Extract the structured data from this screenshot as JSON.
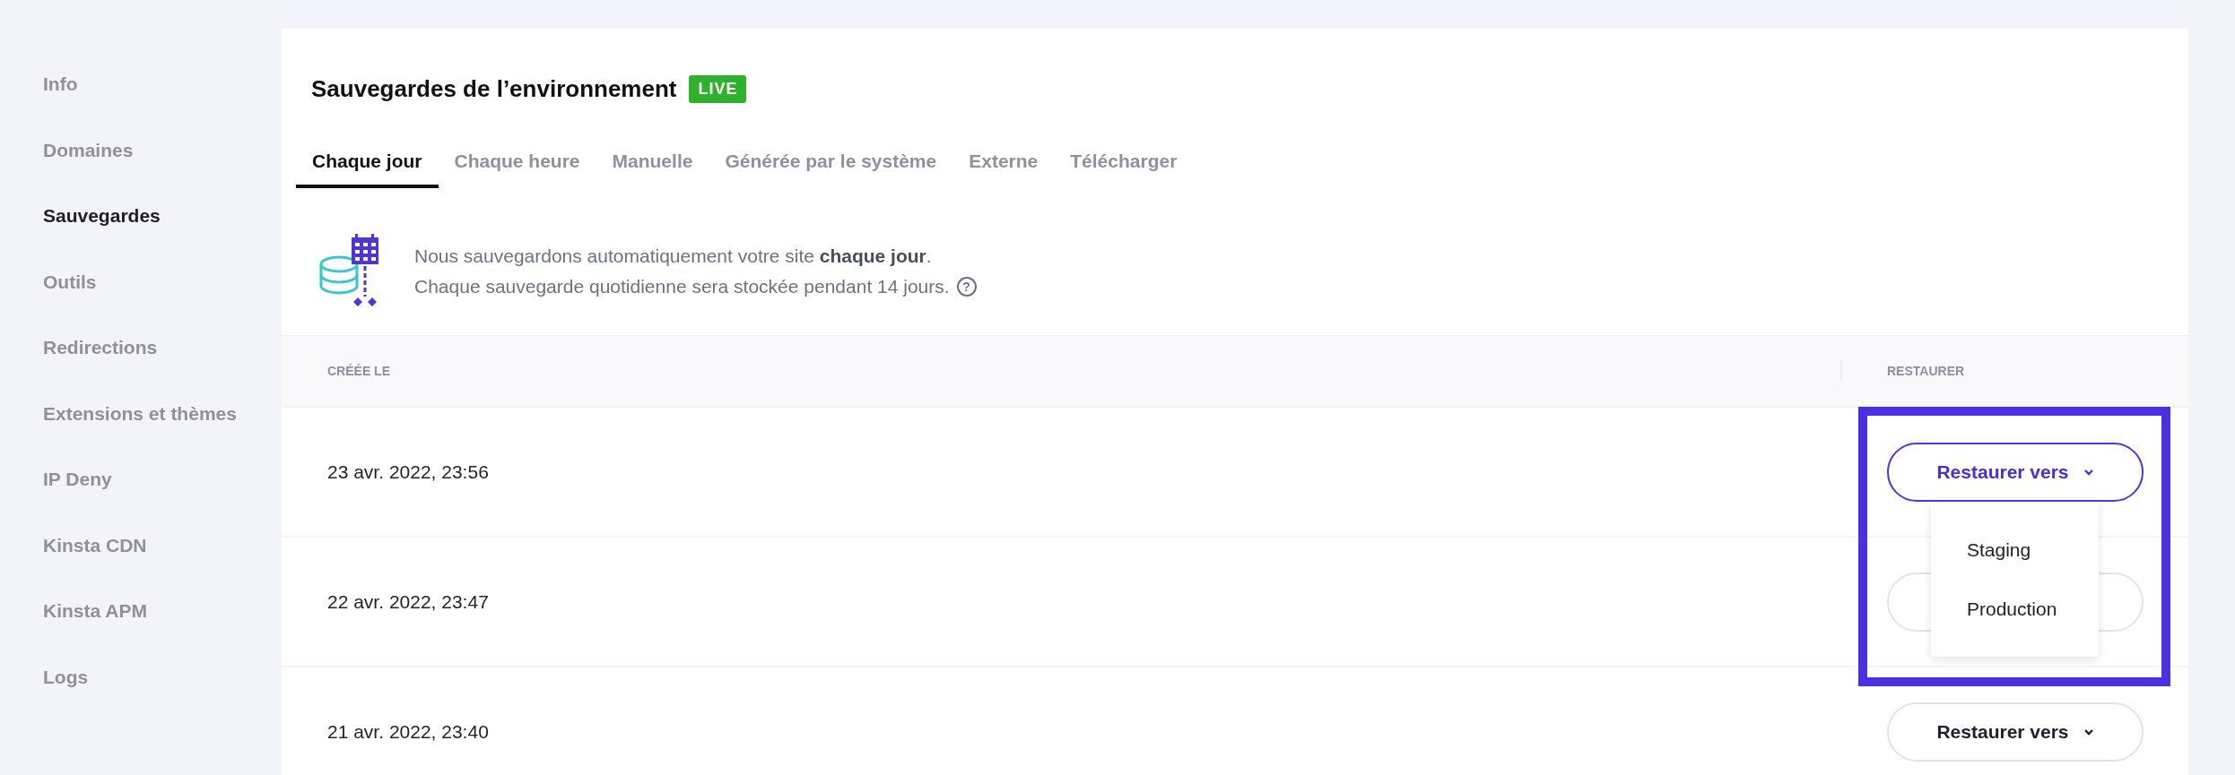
{
  "sidebar": {
    "items": [
      {
        "label": "Info",
        "selected": false
      },
      {
        "label": "Domaines",
        "selected": false
      },
      {
        "label": "Sauvegardes",
        "selected": true
      },
      {
        "label": "Outils",
        "selected": false
      },
      {
        "label": "Redirections",
        "selected": false
      },
      {
        "label": "Extensions et thèmes",
        "selected": false
      },
      {
        "label": "IP Deny",
        "selected": false
      },
      {
        "label": "Kinsta CDN",
        "selected": false
      },
      {
        "label": "Kinsta APM",
        "selected": false
      },
      {
        "label": "Logs",
        "selected": false
      }
    ]
  },
  "panel": {
    "title": "Sauvegardes de l’environnement",
    "badge": "LIVE",
    "tabs": [
      {
        "label": "Chaque jour",
        "selected": true
      },
      {
        "label": "Chaque heure",
        "selected": false
      },
      {
        "label": "Manuelle",
        "selected": false
      },
      {
        "label": "Générée par le système",
        "selected": false
      },
      {
        "label": "Externe",
        "selected": false
      },
      {
        "label": "Télécharger",
        "selected": false
      }
    ],
    "info": [
      "Nous sauvegardons automatiquement votre site **chaque jour**.",
      "Chaque sauvegarde quotidienne sera stockée pendant 14 jours."
    ],
    "help_icon": "?",
    "table": {
      "columns": [
        "CRÉÉE LE",
        "RESTAURER"
      ],
      "rows": [
        {
          "created": "23 avr. 2022, 23:56",
          "button": "Restaurer vers",
          "open": true
        },
        {
          "created": "22 avr. 2022, 23:47",
          "open": false
        },
        {
          "created": "21 avr. 2022, 23:40",
          "button": "Restaurer vers",
          "open": false
        }
      ]
    },
    "dropdown": {
      "items": [
        "Staging",
        "Production"
      ]
    }
  }
}
